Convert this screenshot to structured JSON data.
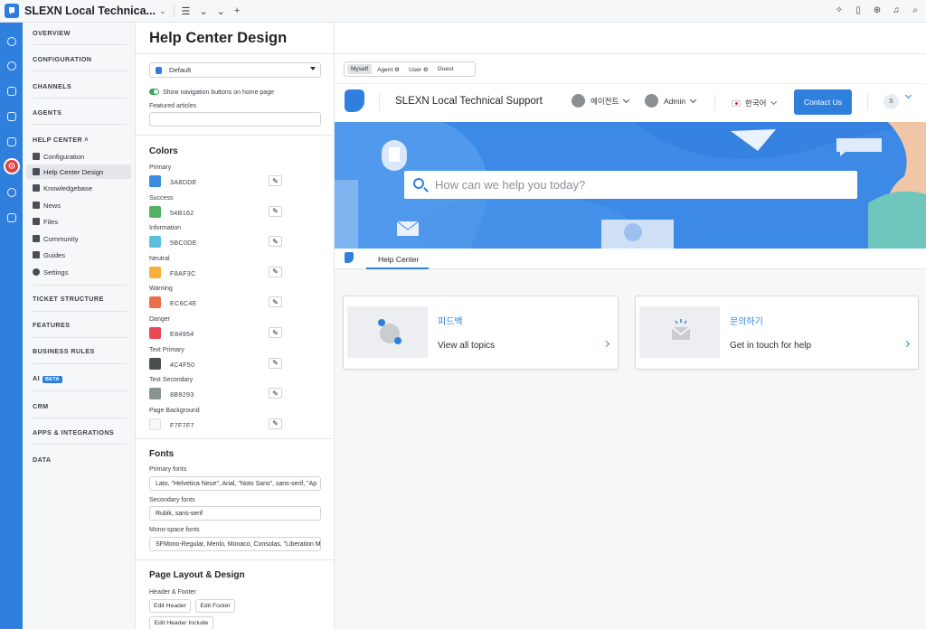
{
  "topbar": {
    "title": "SLEXN Local Technica...",
    "tools": [
      "list-icon",
      "chevron-down-icon",
      "chevron-down-icon",
      "plus-icon"
    ],
    "right_icons": [
      "sparkle-icon",
      "document-icon",
      "upload-icon",
      "bell-icon",
      "search-icon"
    ]
  },
  "nav": {
    "sections": {
      "overview": "OVERVIEW",
      "configuration": "CONFIGURATION",
      "channels": "CHANNELS",
      "agents": "AGENTS",
      "help_center": "HELP CENTER",
      "ticket_structure": "TICKET STRUCTURE",
      "features": "FEATURES",
      "business_rules": "BUSINESS RULES",
      "ai": "AI",
      "ai_badge": "BETA",
      "crm": "CRM",
      "apps": "APPS & INTEGRATIONS",
      "data": "DATA"
    },
    "help_items": [
      "Configuration",
      "Help Center Design",
      "Knowledgebase",
      "News",
      "Files",
      "Community",
      "Guides",
      "Settings"
    ]
  },
  "page": {
    "title": "Help Center Design"
  },
  "settings": {
    "theme_select": "Default",
    "toggle_label": "Show navigation buttons on home page",
    "featured_label": "Featured articles",
    "featured_value": "",
    "colors_heading": "Colors",
    "colors": [
      {
        "label": "Primary",
        "hex": "3A8DDE",
        "color": "#3A8DDE"
      },
      {
        "label": "Success",
        "hex": "54B162",
        "color": "#54B162"
      },
      {
        "label": "Information",
        "hex": "5BC0DE",
        "color": "#5BC0DE"
      },
      {
        "label": "Neutral",
        "hex": "F8AF3C",
        "color": "#F8AF3C"
      },
      {
        "label": "Warning",
        "hex": "EC6C4E",
        "color": "#EC6C4E"
      },
      {
        "label": "Danger",
        "hex": "E84954",
        "color": "#E84954"
      },
      {
        "label": "Text Primary",
        "hex": "4C4F50",
        "color": "#4C4F50"
      },
      {
        "label": "Text Secondary",
        "hex": "8B9293",
        "color": "#8B9293"
      },
      {
        "label": "Page Background",
        "hex": "F7F7F7",
        "color": "#F7F7F7"
      }
    ],
    "fonts_heading": "Fonts",
    "primary_fonts_label": "Primary fonts",
    "primary_fonts": "Lato, \"Helvetica Neue\", Arial, \"Noto Sans\", sans-serif, \"Ap",
    "secondary_fonts_label": "Secondary fonts",
    "secondary_fonts": "Rubik, sans-serif",
    "mono_fonts_label": "Mono-space fonts",
    "mono_fonts": "SFMono-Regular, Menlo, Monaco, Consolas, \"Liberation M",
    "layout_heading": "Page Layout & Design",
    "header_footer_label": "Header & Footer",
    "edit_header": "Edit Header",
    "edit_footer": "Edit Footer",
    "edit_header_include": "Edit Header Include"
  },
  "preview": {
    "roles": [
      "Myself",
      "Agent",
      "User",
      "Guest"
    ],
    "brand": "SLEXN Local Technical Support",
    "agent_menu": "에이전트",
    "admin_menu": "Admin",
    "language": "한국어",
    "contact_button": "Contact Us",
    "profile_initial": "S",
    "search_placeholder": "How can we help you today?",
    "tab_label": "Help Center",
    "cards": [
      {
        "title": "피드백",
        "subtitle": "View all topics"
      },
      {
        "title": "문의하기",
        "subtitle": "Get in touch for help"
      }
    ]
  },
  "colors": {
    "accent": "#2F80DD",
    "rail": "#2F80DD",
    "active_rail": "#E43D3D",
    "hero": "#3C8AE6"
  }
}
